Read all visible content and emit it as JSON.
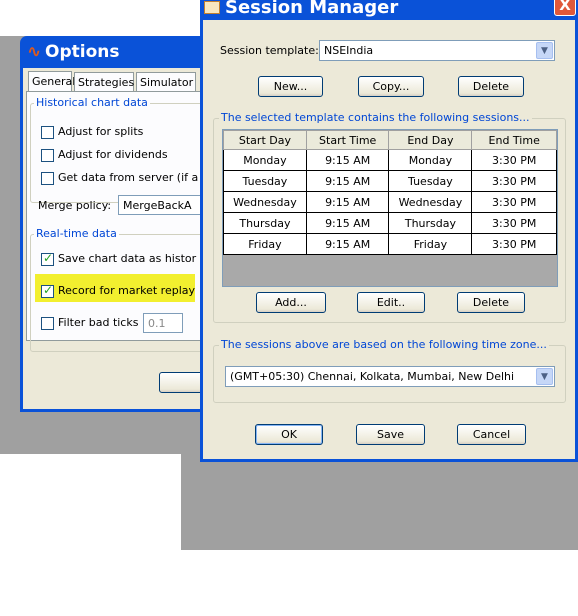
{
  "options": {
    "title": "Options",
    "tabs": [
      "General",
      "Strategies",
      "Simulator"
    ],
    "historical": {
      "group_title": "Historical chart data",
      "items": [
        {
          "label": "Adjust for splits",
          "checked": false
        },
        {
          "label": "Adjust for dividends",
          "checked": false
        },
        {
          "label": "Get data from server (if a",
          "checked": false
        }
      ],
      "merge_label": "Merge policy:",
      "merge_value": "MergeBackA"
    },
    "realtime": {
      "group_title": "Real-time data",
      "save_label": "Save chart data as histor",
      "record_label": "Record for market replay",
      "filter_label": "Filter bad ticks",
      "filter_value": "0.1"
    }
  },
  "session_manager": {
    "title": "Session Manager",
    "close_label": "X",
    "template_label": "Session template:",
    "template_value": "NSEIndia",
    "buttons_top": {
      "new": "New...",
      "copy": "Copy...",
      "delete": "Delete"
    },
    "sessions_group_title": "The selected template contains the following sessions...",
    "table": {
      "headers": [
        "Start Day",
        "Start Time",
        "End Day",
        "End Time"
      ],
      "rows": [
        [
          "Monday",
          "9:15 AM",
          "Monday",
          "3:30 PM"
        ],
        [
          "Tuesday",
          "9:15 AM",
          "Tuesday",
          "3:30 PM"
        ],
        [
          "Wednesday",
          "9:15 AM",
          "Wednesday",
          "3:30 PM"
        ],
        [
          "Thursday",
          "9:15 AM",
          "Thursday",
          "3:30 PM"
        ],
        [
          "Friday",
          "9:15 AM",
          "Friday",
          "3:30 PM"
        ]
      ]
    },
    "buttons_mid": {
      "add": "Add...",
      "edit": "Edit..",
      "delete": "Delete"
    },
    "timezone_group_title": "The sessions above are based on the following time zone...",
    "timezone_value": "(GMT+05:30) Chennai, Kolkata, Mumbai, New Delhi",
    "buttons_bottom": {
      "ok": "OK",
      "save": "Save",
      "cancel": "Cancel"
    }
  },
  "colors": {
    "titlebar": "#0a52d8",
    "group_title": "#0046d5",
    "highlight": "#f2ef2f"
  }
}
